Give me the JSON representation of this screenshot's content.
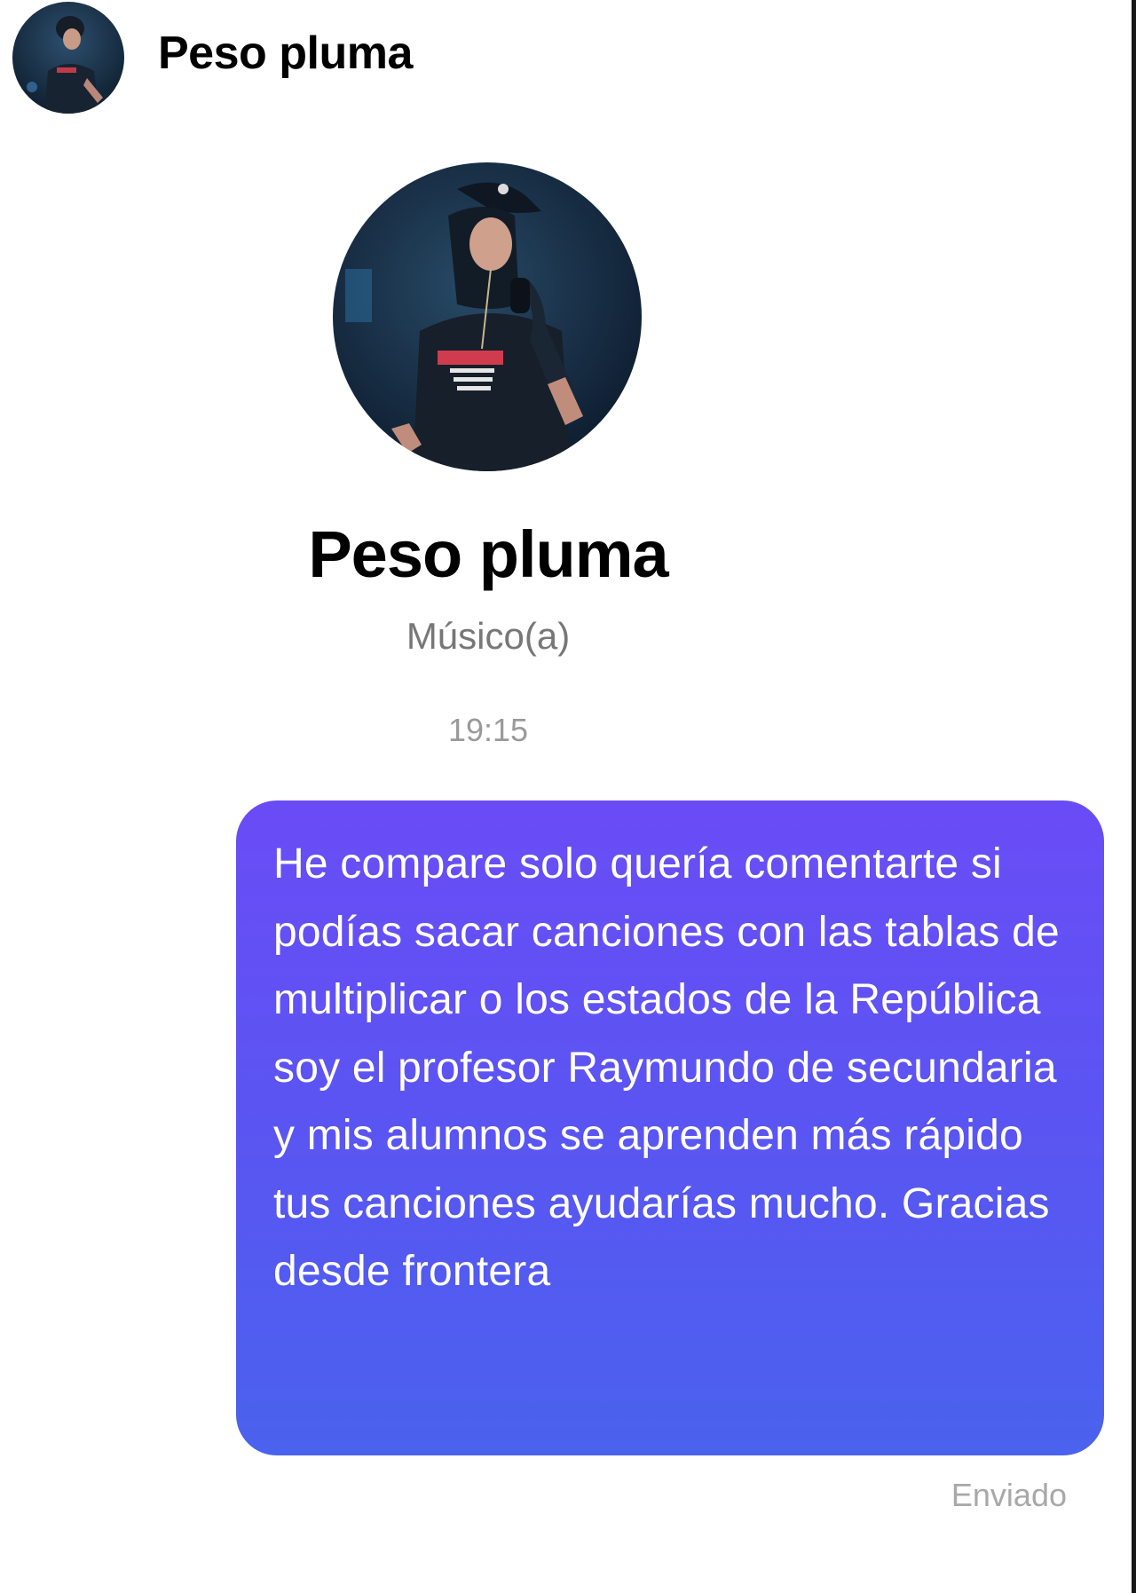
{
  "header": {
    "avatar_icon": "profile-photo",
    "name": "Peso pluma"
  },
  "profile": {
    "avatar_icon": "profile-photo",
    "name": "Peso pluma",
    "role": "Músico(a)"
  },
  "conversation": {
    "timestamp": "19:15",
    "messages": [
      {
        "direction": "outgoing",
        "text": "He compare solo quería comentarte si podías sacar canciones con las tablas de multiplicar o los estados de la República soy el profesor Raymundo de secundaria y mis alumnos se aprenden más rápido tus canciones ayudarías mucho. Gracias desde frontera",
        "status": "Enviado"
      }
    ]
  },
  "colors": {
    "bubble_top": "#6a4cf6",
    "bubble_bottom": "#4a62ee",
    "secondary_text": "#777777"
  }
}
